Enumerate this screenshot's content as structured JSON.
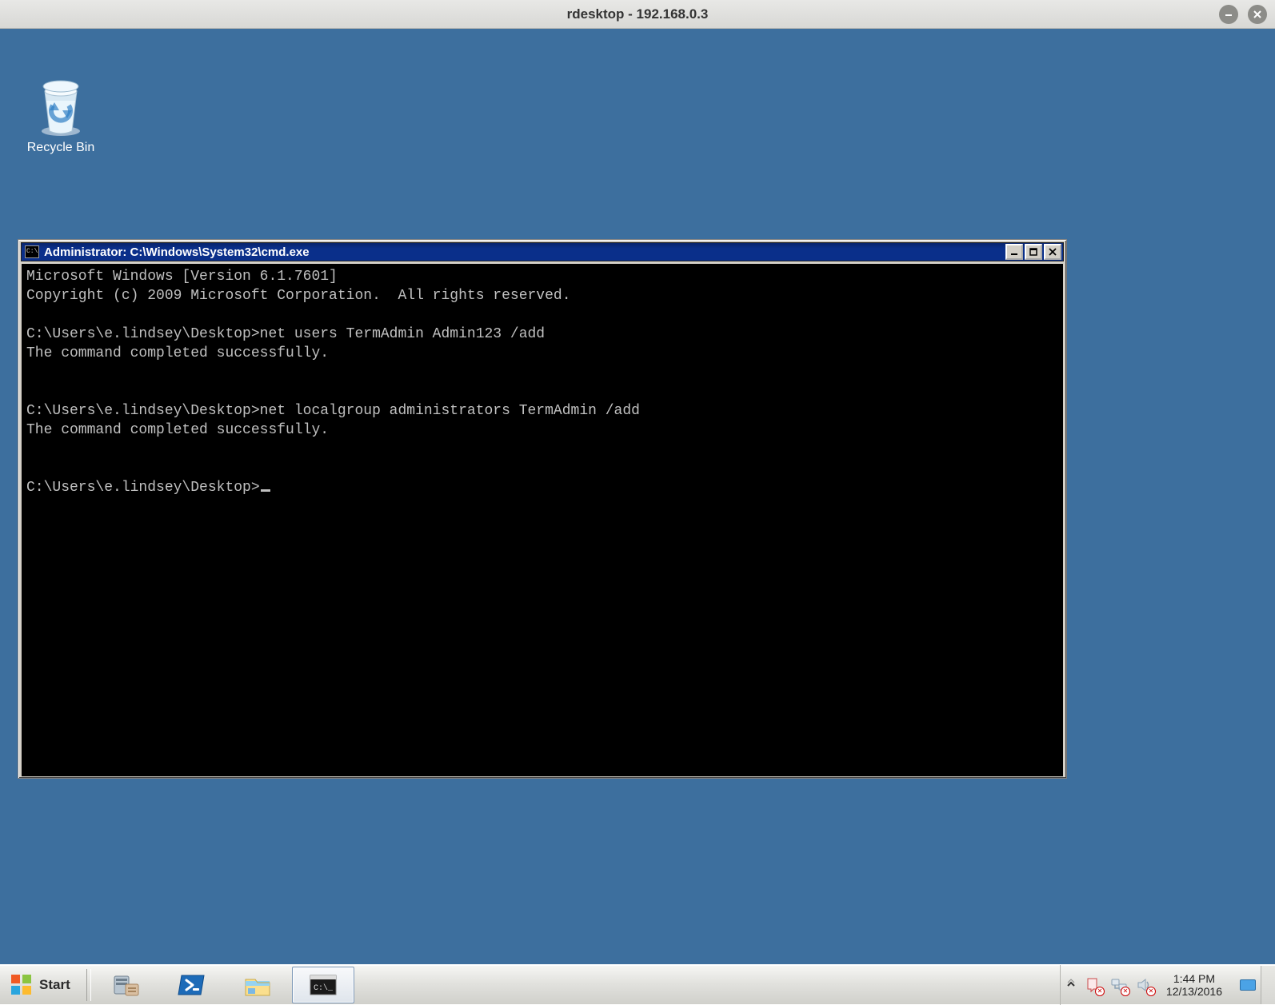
{
  "outer": {
    "title": "rdesktop - 192.168.0.3"
  },
  "desktop": {
    "recycle_bin_label": "Recycle Bin"
  },
  "cmd": {
    "title": "Administrator: C:\\Windows\\System32\\cmd.exe",
    "lines": [
      "Microsoft Windows [Version 6.1.7601]",
      "Copyright (c) 2009 Microsoft Corporation.  All rights reserved.",
      "",
      "C:\\Users\\e.lindsey\\Desktop>net users TermAdmin Admin123 /add",
      "The command completed successfully.",
      "",
      "",
      "C:\\Users\\e.lindsey\\Desktop>net localgroup administrators TermAdmin /add",
      "The command completed successfully.",
      "",
      "",
      "C:\\Users\\e.lindsey\\Desktop>"
    ]
  },
  "taskbar": {
    "start_label": "Start",
    "items": [
      {
        "name": "server-manager",
        "active": false
      },
      {
        "name": "powershell",
        "active": false
      },
      {
        "name": "explorer",
        "active": false
      },
      {
        "name": "cmd",
        "active": true
      }
    ]
  },
  "tray": {
    "time": "1:44 PM",
    "date": "12/13/2016"
  }
}
